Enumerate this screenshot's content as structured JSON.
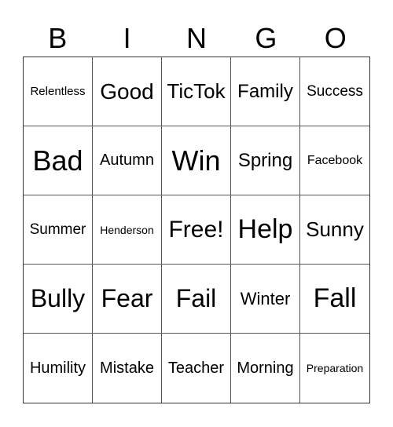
{
  "header": {
    "letters": [
      "B",
      "I",
      "N",
      "G",
      "O"
    ]
  },
  "board": {
    "rows": [
      [
        "Relentless",
        "Good",
        "TicTok",
        "Family",
        "Success"
      ],
      [
        "Bad",
        "Autumn",
        "Win",
        "Spring",
        "Facebook"
      ],
      [
        "Summer",
        "Henderson",
        "Free!",
        "Help",
        "Sunny"
      ],
      [
        "Bully",
        "Fear",
        "Fail",
        "Winter",
        "Fall"
      ],
      [
        "Humility",
        "Mistake",
        "Teacher",
        "Morning",
        "Preparation"
      ]
    ],
    "free_space": "Free!"
  }
}
